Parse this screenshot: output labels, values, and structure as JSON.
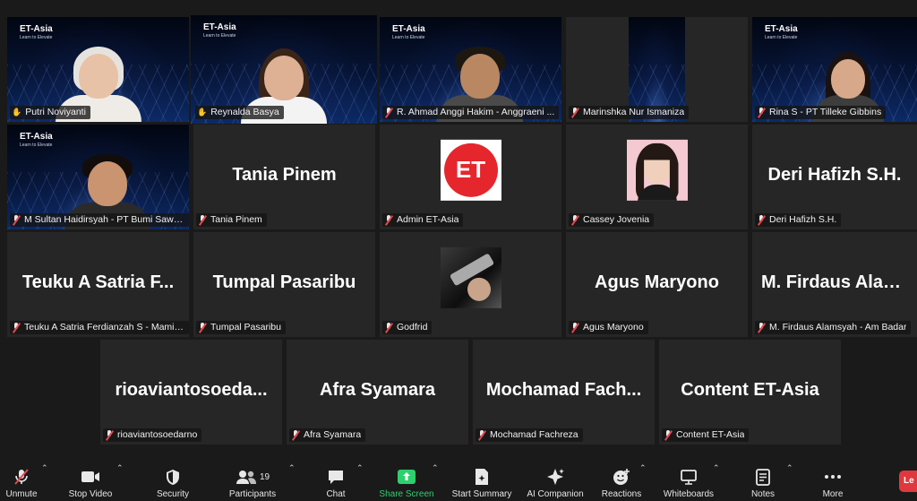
{
  "tiles": [
    {
      "name": "Putri Noviyanti",
      "type": "video",
      "muted": false
    },
    {
      "name": "Reynalda Basya",
      "type": "video",
      "muted": false,
      "speaking": true
    },
    {
      "name": "R. Ahmad Anggi Hakim - Anggraeni ...",
      "type": "video",
      "muted": true
    },
    {
      "name": "Marinshka Nur Ismaniza",
      "type": "video",
      "muted": true
    },
    {
      "name": "Rina S - PT Tilleke Gibbins",
      "type": "video",
      "muted": true
    },
    {
      "name": "M Sultan Haidirsyah - PT Bumi Sawit ...",
      "type": "video",
      "muted": true
    },
    {
      "name": "Tania Pinem",
      "display": "Tania Pinem",
      "type": "name",
      "muted": true
    },
    {
      "name": "Admin ET-Asia",
      "type": "avatar",
      "muted": true,
      "avatar_text": "ET"
    },
    {
      "name": "Cassey Jovenia",
      "type": "avatar",
      "muted": true
    },
    {
      "name": "Deri Hafizh S.H.",
      "display": "Deri Hafizh S.H.",
      "type": "name",
      "muted": true
    },
    {
      "name": "Teuku A Satria Ferdianzah S - Mamik...",
      "display": "Teuku A Satria F...",
      "type": "name",
      "muted": true
    },
    {
      "name": "Tumpal Pasaribu",
      "display": "Tumpal Pasaribu",
      "type": "name",
      "muted": true
    },
    {
      "name": "Godfrid",
      "type": "avatar",
      "muted": true
    },
    {
      "name": "Agus Maryono",
      "display": "Agus Maryono",
      "type": "name",
      "muted": true
    },
    {
      "name": "M. Firdaus Alamsyah - Am Badar",
      "display": "M. Firdaus Alam...",
      "type": "name",
      "muted": true
    },
    {
      "name": "rioaviantosoedarno",
      "display": "rioaviantosoeda...",
      "type": "name",
      "muted": true
    },
    {
      "name": "Afra Syamara",
      "display": "Afra Syamara",
      "type": "name",
      "muted": true
    },
    {
      "name": "Mochamad Fachreza",
      "display": "Mochamad  Fach...",
      "type": "name",
      "muted": true
    },
    {
      "name": "Content ET-Asia",
      "display": "Content ET-Asia",
      "type": "name",
      "muted": true
    }
  ],
  "brand": {
    "title": "ET-Asia",
    "tagline": "Learn to Elevate"
  },
  "toolbar": {
    "unmute": "Unmute",
    "stop_video": "Stop Video",
    "security": "Security",
    "participants": "Participants",
    "participants_count": "19",
    "chat": "Chat",
    "share_screen": "Share Screen",
    "start_summary": "Start Summary",
    "ai_companion": "AI Companion",
    "reactions": "Reactions",
    "whiteboards": "Whiteboards",
    "notes": "Notes",
    "more": "More",
    "leave": "Le"
  },
  "colors": {
    "speaking_border": "#d4e76b",
    "share_green": "#2ed06e",
    "muted_red": "#e5484d",
    "leave_red": "#e0383e"
  }
}
